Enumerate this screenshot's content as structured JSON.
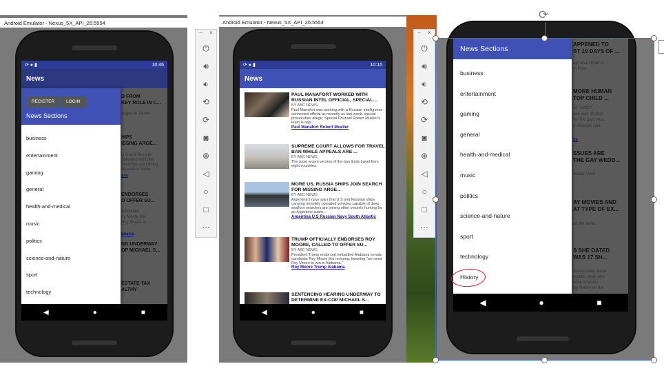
{
  "emulator1": {
    "title": "Android Emulator - Nexus_5X_API_26:5554",
    "status_time": "10:46",
    "app_title": "News",
    "register_label": "REGISTER",
    "login_label": "LOGIN",
    "drawer_header": "News Sections",
    "sections": [
      "business",
      "entertainment",
      "gaming",
      "general",
      "health-and-medical",
      "music",
      "politics",
      "science-and-nature",
      "sport",
      "technology"
    ],
    "bg_headlines": [
      "D FROM",
      "KEY ROLE IN C...",
      "HIPS",
      "ISSING ARGE...",
      "ENDORSES",
      "O OFFER SU...",
      "NG UNDERWAY",
      "OP MICHAEL S...",
      "ESTATE TAX",
      "ALTHY"
    ],
    "bg_snippets": [
      "anges to James",
      "U.S and Russian",
      "operated vehicles",
      "searches are joining",
      "Argentine subm...",
      "embattled",
      "ny Moore this",
      "Roy Moore to"
    ],
    "bg_links": [
      "avy",
      "abama"
    ]
  },
  "emulator2": {
    "title": "Android Emulator - Nexus_5X_API_26:5554",
    "status_time": "10:15",
    "app_title": "News",
    "articles": [
      {
        "headline": "PAUL MANAFORT WORKED WITH RUSSIAN INTEL OFFICIAL, SPECIAL...",
        "source": "BY ABC NEWS",
        "desc": "Paul Manafort was working with a Russian intelligence-connected official as recently as last week, special prosecutors allege. Special Counsel Robert Mueller's team is reje...",
        "tags": "Paul Manafort Robert Mueller"
      },
      {
        "headline": "SUPREME COURT ALLOWS FOR TRAVEL BAN WHILE APPEALS ARE ...",
        "source": "BY ABC NEWS",
        "desc": "The most recent version of the ban limits travel from eight countries.",
        "tags": ""
      },
      {
        "headline": "MORE US, RUSSIA SHIPS JOIN SEARCH FOR MISSING ARGE...",
        "source": "BY ABC NEWS",
        "desc": "Argentina's navy says that U.S and Russian ships carrying remotely operated vehicles capable of deep seafloor searches are joining other vessels hunting for an Argentine subm...",
        "tags": "Argentina U.S Russian Navy South Atlantic"
      },
      {
        "headline": "TRUMP OFFICIALLY ENDORSES ROY MOORE, CALLED TO OFFER SU...",
        "source": "BY ABC NEWS",
        "desc": "President Trump endorsed embattled Alabama senate candidate Roy Moore this morning, tweeting \"we need Roy Moore to win in Alabama.\"",
        "tags": "Roy Moore Trump Alabama"
      },
      {
        "headline": "SENTENCING HEARING UNDERWAY TO DETERMINE EX-COP MICHAEL S...",
        "source": "",
        "desc": "",
        "tags": ""
      }
    ]
  },
  "emulator3": {
    "drawer_header": "News Sections",
    "sections": [
      "business",
      "entertainment",
      "gaming",
      "general",
      "health-and-medical",
      "music",
      "politics",
      "science-and-nature",
      "sport",
      "technology",
      "History"
    ],
    "bg_headlines": [
      "APPENED TO",
      "ST 10 DAYS OF ...",
      "MORE HUMAN",
      "TOP CHILD ...",
      "SSUES ARE",
      "THE GAY WEDD...",
      "AY MOVIES AND",
      "AT TYPE OF EX...",
      "S SHE DATED",
      "WAS 17 SH..."
    ],
    "bg_snippets": [
      "ept alsa I lived in",
      "rh Post -",
      "AY SMIDT",
      "ove over 10,800",
      "ver the past year,",
      "n Wojcicki said.",
      "esday. View",
      "all the same.",
      "onsensually dated",
      "ngdate when she",
      "ence to prove",
      "ng history on the"
    ],
    "bg_links": [
      "be"
    ]
  },
  "toolbar": {
    "icons": [
      "power-icon",
      "volume-up-icon",
      "volume-down-icon",
      "rotate-left-icon",
      "rotate-right-icon",
      "camera-icon",
      "zoom-icon",
      "back-icon",
      "home-icon",
      "overview-icon",
      "more-icon"
    ]
  },
  "colors": {
    "primary": "#3f51b5",
    "status": "#2d3c97",
    "link": "#1a0dab",
    "annotation": "#e02020"
  }
}
